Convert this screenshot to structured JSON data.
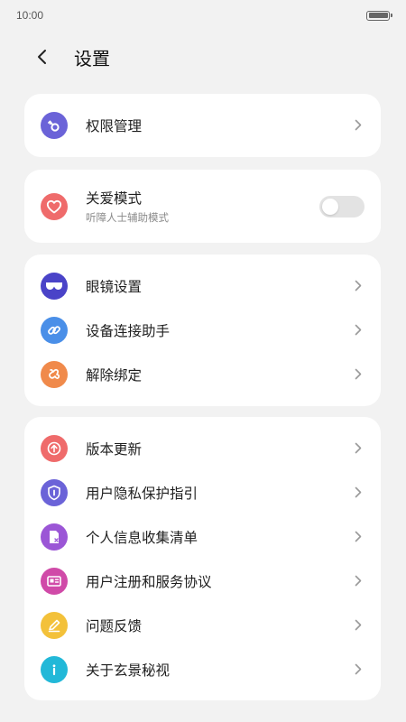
{
  "status_bar": {
    "time": "10:00"
  },
  "header": {
    "title": "设置"
  },
  "permissions": {
    "label": "权限管理",
    "color": "#6b63d8"
  },
  "care_mode": {
    "label": "关爱模式",
    "sublabel": "听障人士辅助模式",
    "enabled": false,
    "color": "#ef6b6b"
  },
  "device_items": [
    {
      "label": "眼镜设置",
      "icon": "glasses-icon",
      "color": "#4a43c8"
    },
    {
      "label": "设备连接助手",
      "icon": "link-icon",
      "color": "#4a8fe8"
    },
    {
      "label": "解除绑定",
      "icon": "unbind-icon",
      "color": "#f08a4b"
    }
  ],
  "about_items": [
    {
      "label": "版本更新",
      "icon": "upload-icon",
      "color": "#ef6b6b"
    },
    {
      "label": "用户隐私保护指引",
      "icon": "shield-icon",
      "color": "#6b63d8"
    },
    {
      "label": "个人信息收集清单",
      "icon": "document-icon",
      "color": "#9b56d6"
    },
    {
      "label": "用户注册和服务协议",
      "icon": "id-card-icon",
      "color": "#d04aa8"
    },
    {
      "label": "问题反馈",
      "icon": "pencil-icon",
      "color": "#f3c13a"
    },
    {
      "label": "关于玄景秘视",
      "icon": "info-icon",
      "color": "#22b8d8"
    }
  ]
}
